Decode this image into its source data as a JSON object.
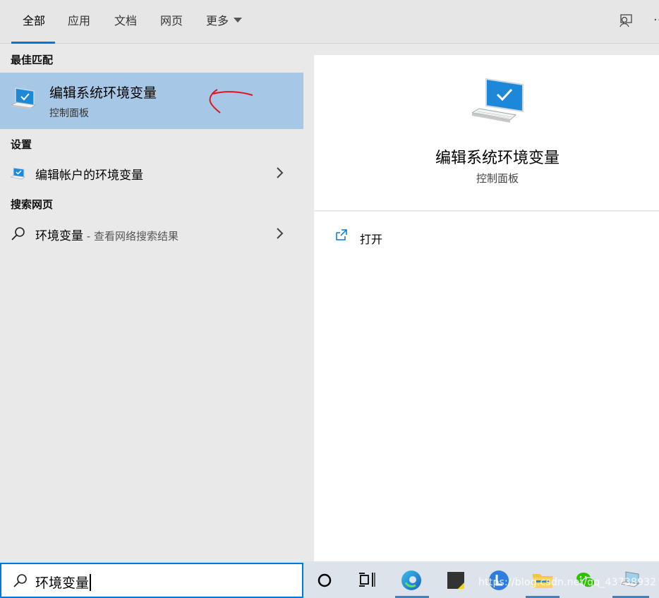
{
  "tabs": [
    {
      "label": "全部",
      "active": true
    },
    {
      "label": "应用",
      "active": false
    },
    {
      "label": "文档",
      "active": false
    },
    {
      "label": "网页",
      "active": false
    },
    {
      "label": "更多",
      "active": false
    }
  ],
  "toolbar": {
    "feedback_icon": "feedback-icon",
    "more_options_icon": "ellipsis-icon",
    "more_options_label": "···"
  },
  "best_match": {
    "heading": "最佳匹配",
    "title": "编辑系统环境变量",
    "subtitle": "控制面板",
    "icon": "monitor-check-icon"
  },
  "settings": {
    "heading": "设置",
    "items": [
      {
        "label": "编辑帐户的环境变量",
        "icon": "monitor-check-icon"
      }
    ]
  },
  "web_search": {
    "heading": "搜索网页",
    "items": [
      {
        "label": "环境变量",
        "suffix": " - 查看网络搜索结果",
        "icon": "search-icon"
      }
    ]
  },
  "preview": {
    "title": "编辑系统环境变量",
    "subtitle": "控制面板",
    "actions": [
      {
        "label": "打开",
        "icon": "open-icon"
      }
    ]
  },
  "search": {
    "value": "环境变量",
    "icon": "search-icon"
  },
  "taskbar": {
    "items": [
      "cortana-icon",
      "task-view-icon",
      "edge-icon",
      "sticky-notes-icon",
      "lanzou-icon",
      "file-explorer-icon",
      "wechat-icon",
      "control-panel-icon"
    ],
    "watermark": "https://blog.csdn.net/qq_43738932"
  },
  "colors": {
    "accent": "#0078d7",
    "selection": "#a6c8e6",
    "annotation": "#e0141e"
  }
}
